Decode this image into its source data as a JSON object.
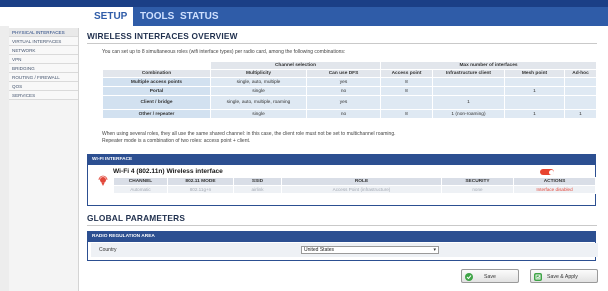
{
  "top_nav": {
    "tabs": [
      {
        "label": "SETUP"
      },
      {
        "label": "TOOLS"
      },
      {
        "label": "STATUS"
      }
    ]
  },
  "sidebar": {
    "items": [
      {
        "label": "PHYSICAL INTERFACES"
      },
      {
        "label": "VIRTUAL INTERFACES"
      },
      {
        "label": "NETWORK"
      },
      {
        "label": "VPN"
      },
      {
        "label": "BRIDGING"
      },
      {
        "label": "ROUTING / FIREWALL"
      },
      {
        "label": "QOS"
      },
      {
        "label": "SERVICES"
      }
    ]
  },
  "wireless": {
    "title": "WIRELESS INTERFACES OVERVIEW",
    "intro": "You can set up to 8 simultaneous roles (wifi interface types) per radio card, among the following combinations:",
    "group_channel": "Channel selection",
    "group_max": "Max number of interfaces",
    "columns": [
      "Combination",
      "Multiplicity",
      "Can use DFS",
      "Access point",
      "Infrastructure client",
      "Mesh point",
      "Ad-hoc"
    ],
    "rows": [
      {
        "combination": "Multiple access points",
        "multiplicity": "single, auto, multiple",
        "dfs": "yes",
        "ap": "8",
        "infra": "",
        "mesh": "",
        "adhoc": ""
      },
      {
        "combination": "Portal",
        "multiplicity": "single",
        "dfs": "no",
        "ap": "8",
        "infra": "",
        "mesh": "1",
        "adhoc": ""
      },
      {
        "combination": "Client / bridge",
        "multiplicity": "single, auto, multiple, roaming",
        "dfs": "yes",
        "ap": "",
        "infra": "1",
        "mesh": "",
        "adhoc": ""
      },
      {
        "combination": "Other / repeater",
        "multiplicity": "single",
        "dfs": "no",
        "ap": "8",
        "infra": "1 (non-roaming)",
        "mesh": "1",
        "adhoc": "1"
      }
    ],
    "note1": "When using several roles, they all use the same shared channel: in this case, the client role must not be set to multichannel roaming.",
    "note2": "Repeater mode is a combination of two roles: access point + client."
  },
  "wifi_panel": {
    "header": "WI-FI INTERFACE",
    "interface_title": "Wi-Fi 4 (802.11n) Wireless interface",
    "toggle_state": "off",
    "columns": [
      "CHANNEL",
      "802.11 MODE",
      "SSID",
      "ROLE",
      "SECURITY",
      "ACTIONS"
    ],
    "row": {
      "channel": "Automatic",
      "mode": "802.11g+n",
      "ssid": "airlink",
      "role": "Access Point (infrastructure)",
      "security": "none",
      "actions": "Interface disabled"
    },
    "colors": {
      "disabled_text": "#e2473a",
      "toggle": "#e8432f"
    }
  },
  "global": {
    "title": "GLOBAL PARAMETERS",
    "radio_header": "RADIO REGULATION AREA",
    "country_label": "Country",
    "country_value": "United States"
  },
  "buttons": {
    "save": "Save",
    "save_apply": "Save & Apply"
  },
  "colors": {
    "accent": "#2f5ca8",
    "panel_header": "#2c4f91",
    "button_icon": "#3fa447"
  }
}
